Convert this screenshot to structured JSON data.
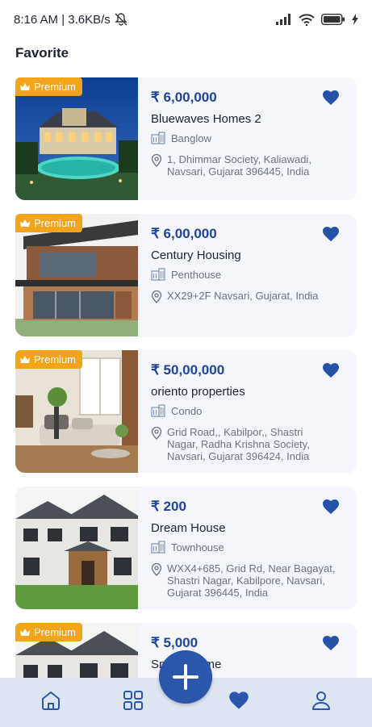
{
  "status_bar": {
    "time_network": "8:16 AM | 3.6KB/s",
    "icons": [
      "mute-icon",
      "signal-icon",
      "wifi-icon",
      "battery-icon",
      "charging-icon"
    ]
  },
  "page": {
    "title": "Favorite"
  },
  "colors": {
    "accent": "#20449a",
    "fab": "#2a56ab",
    "premium": "#f2a51a",
    "card_bg": "#f4f6fb",
    "nav_bg": "#dde5f2"
  },
  "favorites": [
    {
      "badge": "Premium",
      "price": "₹ 6,00,000",
      "name": "Bluewaves Homes 2",
      "type": "Banglow",
      "address": "1, Dhimmar Society, Kaliawadi, Navsari, Gujarat 396445, India",
      "image": "pool-villa-night"
    },
    {
      "badge": "Premium",
      "price": "₹ 6,00,000",
      "name": "Century Housing",
      "type": "Penthouse",
      "address": "XX29+2F Navsari, Gujarat, India",
      "image": "modern-wood-house"
    },
    {
      "badge": "Premium",
      "price": "₹ 50,00,000",
      "name": "oriento properties",
      "type": "Condo",
      "address": "Grid Road,, Kabilpor,, Shastri Nagar, Radha Krishna Society, Navsari, Gujarat 396424, India",
      "image": "living-room-interior"
    },
    {
      "badge": "",
      "price": "₹ 200",
      "name": "Dream House",
      "type": "Townhouse",
      "address": "WXX4+685, Grid Rd, Near Bagayat, Shastri Nagar, Kabilpore, Navsari, Gujarat 396445, India",
      "image": "townhouse-exterior"
    },
    {
      "badge": "Premium",
      "price": "₹ 5,000",
      "name": "Sm",
      "name_tail": "me",
      "type": "",
      "address": "",
      "image": "townhouse-exterior"
    }
  ],
  "bottom_nav": {
    "items": [
      "home-icon",
      "grid-icon",
      "heart-icon",
      "profile-icon"
    ],
    "active": "heart-icon",
    "fab_icon": "plus-icon"
  }
}
